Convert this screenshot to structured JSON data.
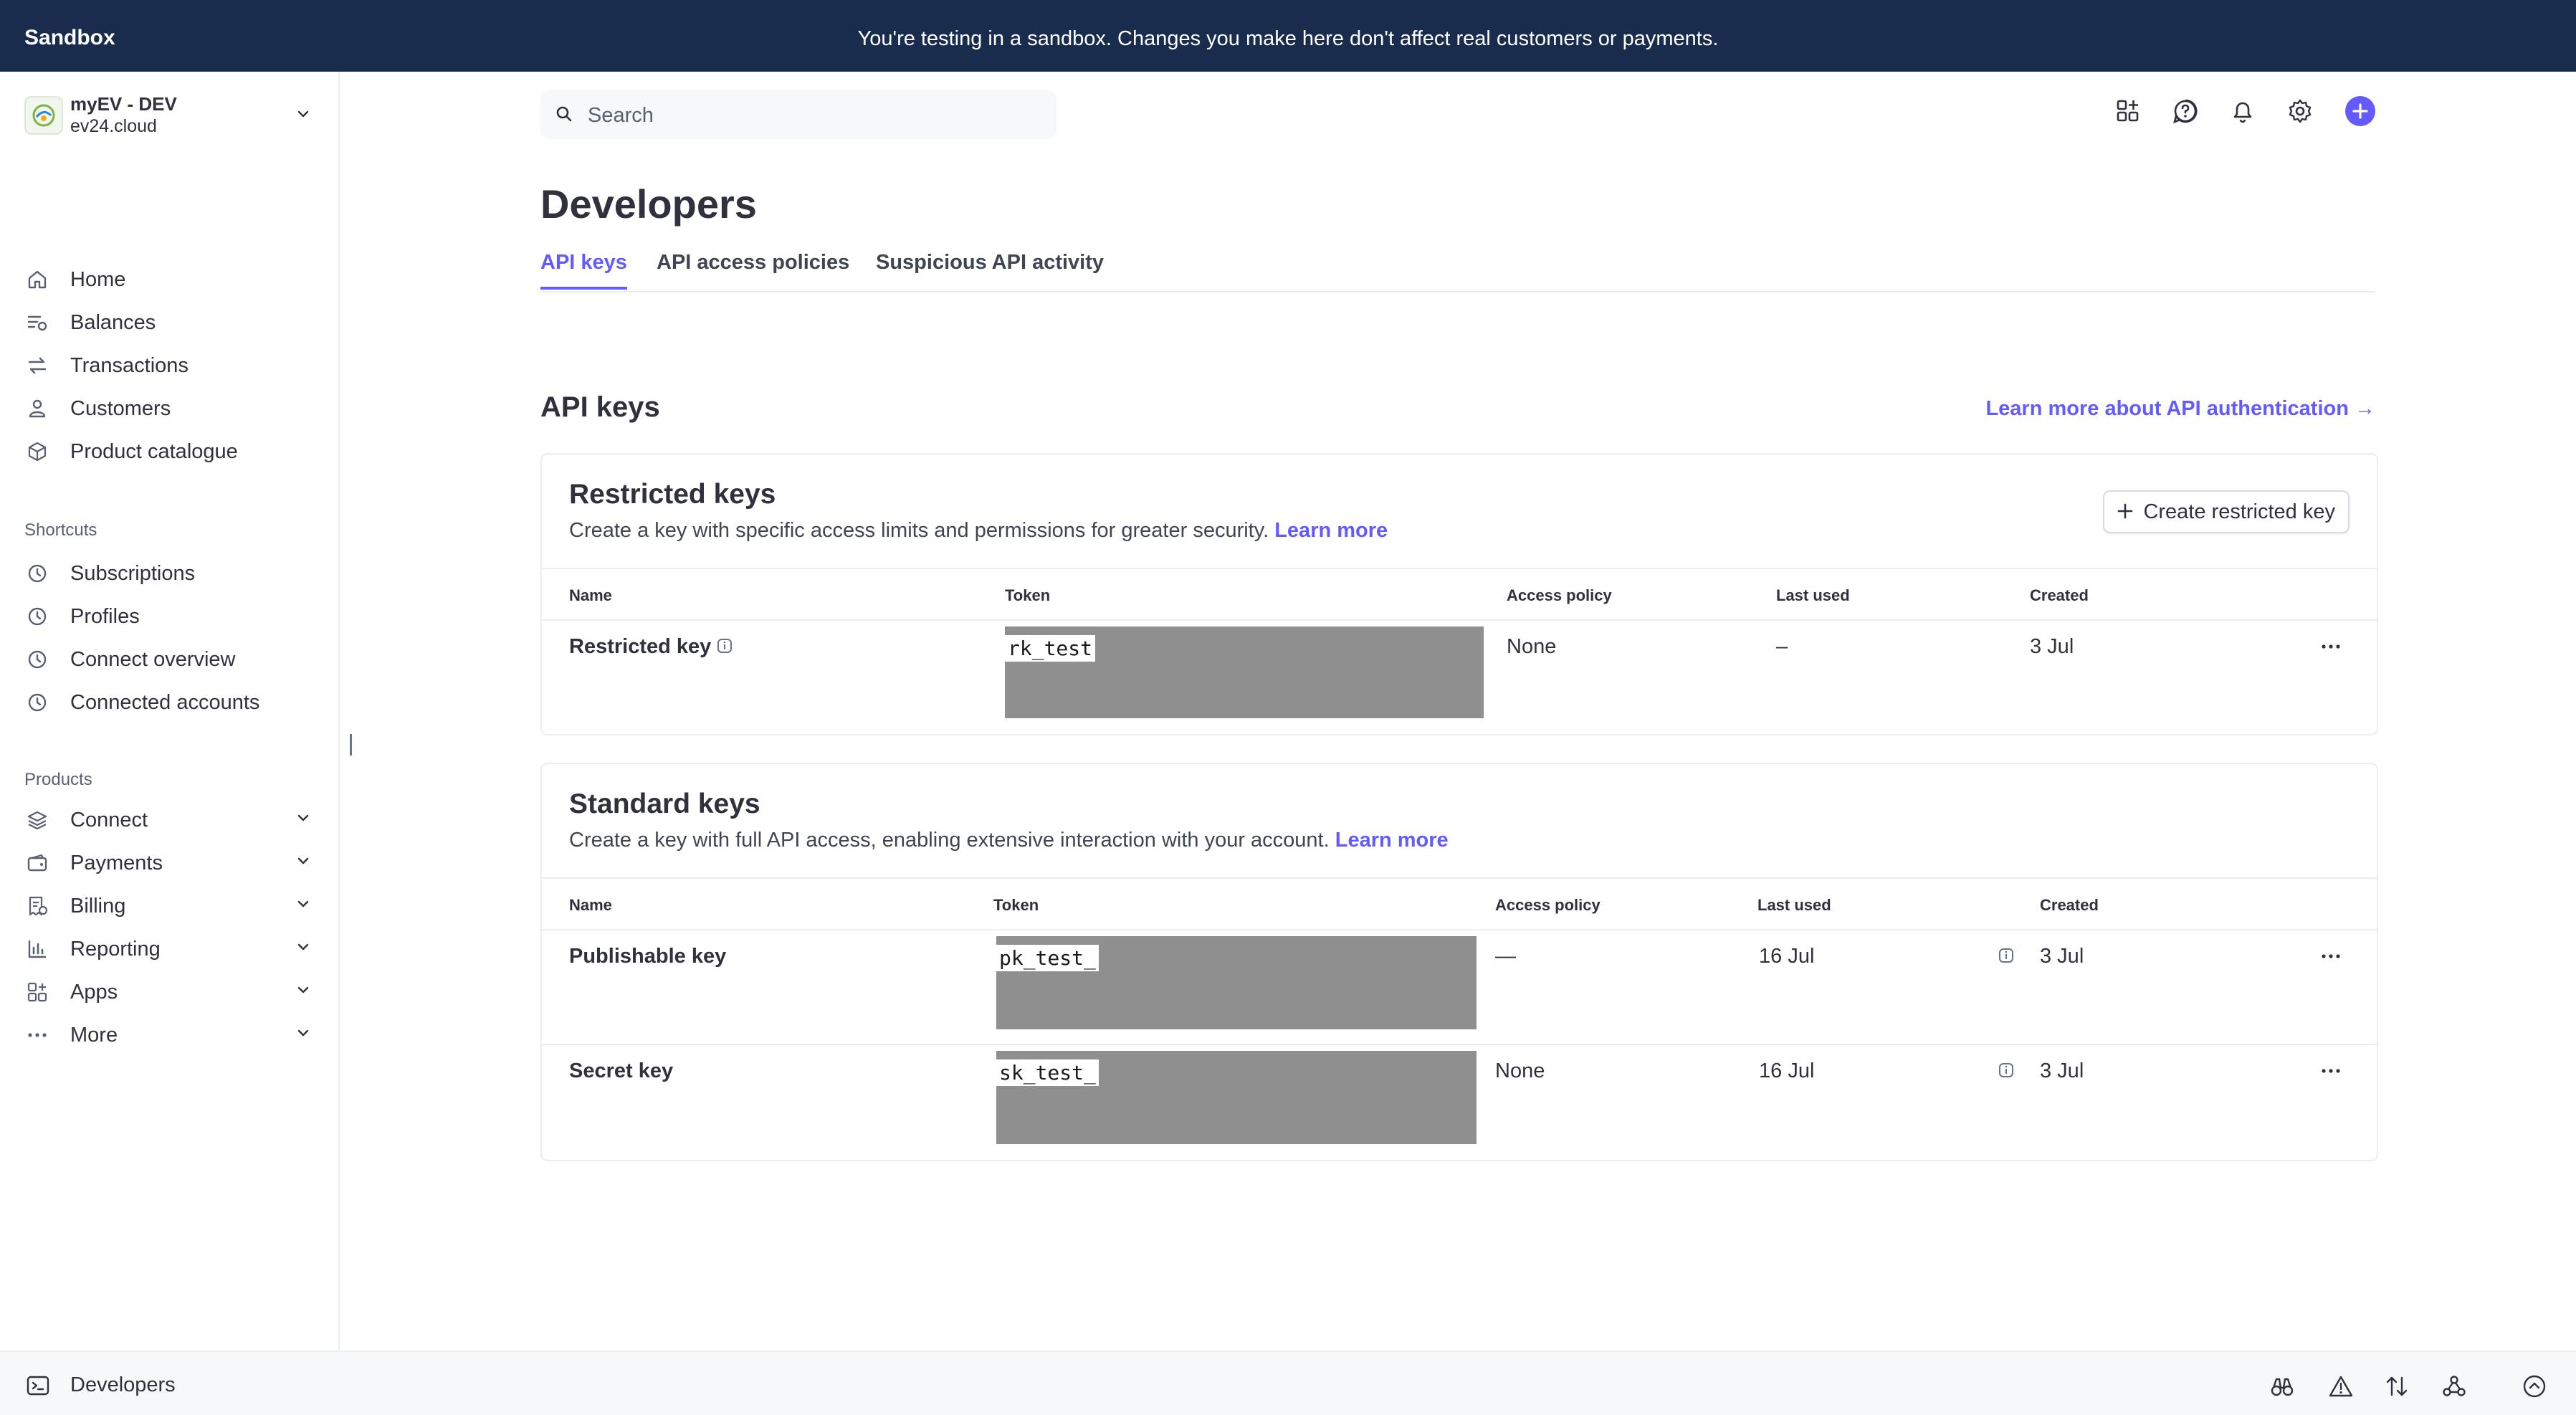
{
  "banner": {
    "label": "Sandbox",
    "message": "You're testing in a sandbox. Changes you make here don't affect real customers or payments."
  },
  "account": {
    "name": "myEV - DEV",
    "domain": "ev24.cloud"
  },
  "nav": {
    "main": [
      {
        "label": "Home",
        "icon": "home-icon"
      },
      {
        "label": "Balances",
        "icon": "balances-icon"
      },
      {
        "label": "Transactions",
        "icon": "transactions-icon"
      },
      {
        "label": "Customers",
        "icon": "customers-icon"
      },
      {
        "label": "Product catalogue",
        "icon": "product-catalogue-icon"
      }
    ],
    "shortcuts_title": "Shortcuts",
    "shortcuts": [
      {
        "label": "Subscriptions",
        "icon": "clock-icon"
      },
      {
        "label": "Profiles",
        "icon": "clock-icon"
      },
      {
        "label": "Connect overview",
        "icon": "clock-icon"
      },
      {
        "label": "Connected accounts",
        "icon": "clock-icon"
      }
    ],
    "products_title": "Products",
    "products": [
      {
        "label": "Connect",
        "icon": "connect-icon"
      },
      {
        "label": "Payments",
        "icon": "payments-icon"
      },
      {
        "label": "Billing",
        "icon": "billing-icon"
      },
      {
        "label": "Reporting",
        "icon": "reporting-icon"
      },
      {
        "label": "Apps",
        "icon": "apps-icon"
      },
      {
        "label": "More",
        "icon": "more-icon"
      }
    ]
  },
  "search": {
    "placeholder": "Search"
  },
  "page": {
    "title": "Developers",
    "tabs": [
      "API keys",
      "API access policies",
      "Suspicious API activity"
    ],
    "active_tab": "API keys",
    "section_title": "API keys",
    "learn_more_auth": "Learn more about API authentication →"
  },
  "restricted": {
    "title": "Restricted keys",
    "description": "Create a key with specific access limits and permissions for greater security.",
    "learn_more": "Learn more",
    "create_button": "Create restricted key",
    "columns": [
      "Name",
      "Token",
      "Access policy",
      "Last used",
      "Created"
    ],
    "rows": [
      {
        "name": "Restricted key",
        "token_prefix": "rk_test",
        "access_policy": "None",
        "last_used": "–",
        "created": "3 Jul"
      }
    ]
  },
  "standard": {
    "title": "Standard keys",
    "description": "Create a key with full API access, enabling extensive interaction with your account.",
    "learn_more": "Learn more",
    "columns": [
      "Name",
      "Token",
      "Access policy",
      "Last used",
      "Created"
    ],
    "rows": [
      {
        "name": "Publishable key",
        "token_prefix": "pk_test_",
        "access_policy": "—",
        "last_used": "16 Jul",
        "created": "3 Jul"
      },
      {
        "name": "Secret key",
        "token_prefix": "sk_test_",
        "access_policy": "None",
        "last_used": "16 Jul",
        "created": "3 Jul"
      }
    ]
  },
  "bottom": {
    "label": "Developers"
  },
  "colors": {
    "banner": "#1a2c4e",
    "accent": "#635bff",
    "text": "#30313d",
    "redaction": "#8f8f8f"
  }
}
